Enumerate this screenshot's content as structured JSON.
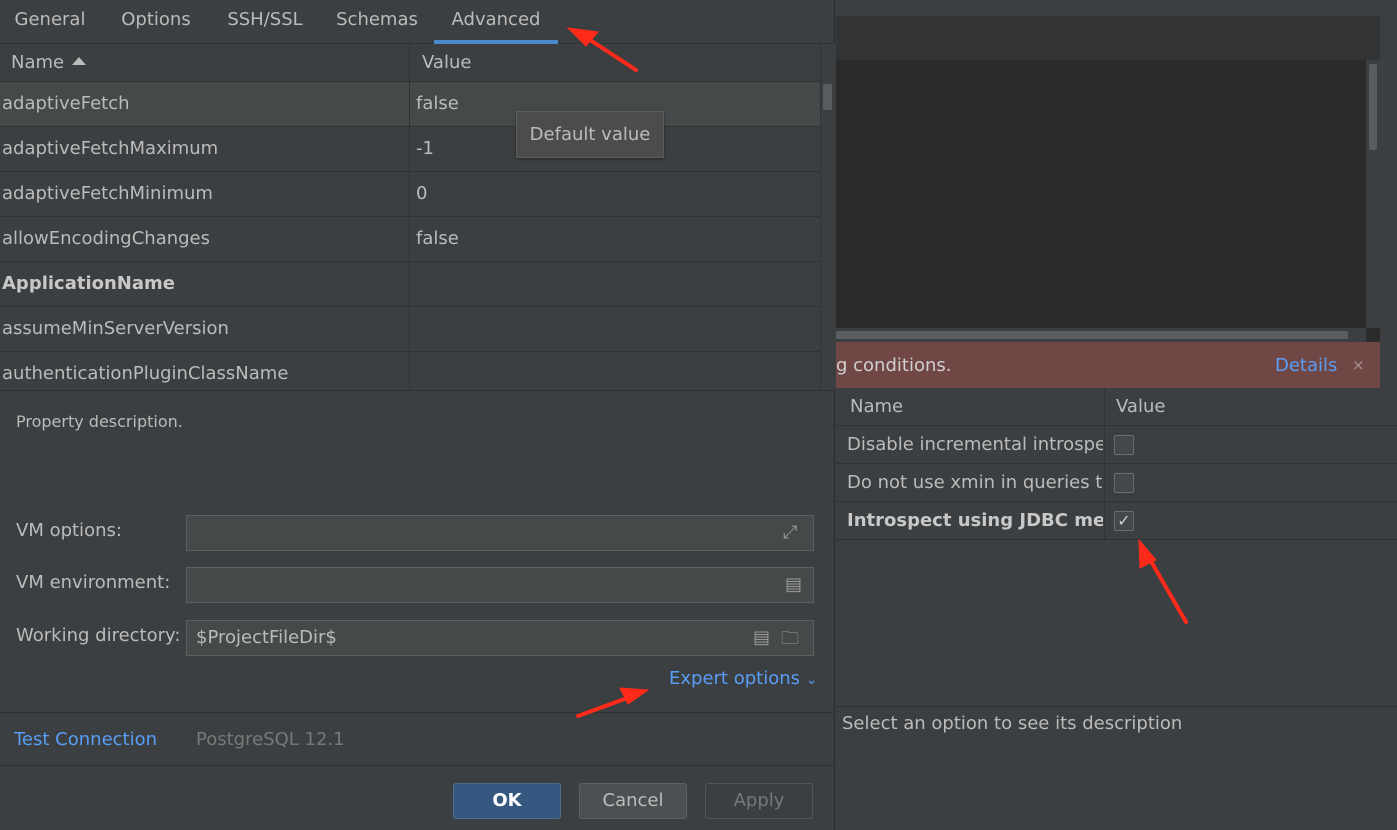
{
  "tabs": [
    {
      "label": "General"
    },
    {
      "label": "Options"
    },
    {
      "label": "SSH/SSL"
    },
    {
      "label": "Schemas"
    },
    {
      "label": "Advanced"
    }
  ],
  "active_tab": "Advanced",
  "properties_grid": {
    "col_name": "Name",
    "col_value": "Value",
    "rows": [
      {
        "name": "adaptiveFetch",
        "value": "false"
      },
      {
        "name": "adaptiveFetchMaximum",
        "value": "-1"
      },
      {
        "name": "adaptiveFetchMinimum",
        "value": "0"
      },
      {
        "name": "allowEncodingChanges",
        "value": "false"
      },
      {
        "name": "ApplicationName",
        "value": ""
      },
      {
        "name": "assumeMinServerVersion",
        "value": ""
      },
      {
        "name": "authenticationPluginClassName",
        "value": ""
      }
    ]
  },
  "tooltip": "Default value",
  "property_description": "Property description.",
  "fields": {
    "vm_options_label": "VM options:",
    "vm_options_value": "",
    "vm_env_label": "VM environment:",
    "vm_env_value": "",
    "workdir_label": "Working directory:",
    "workdir_value": "$ProjectFileDir$"
  },
  "expert_options": "Expert options",
  "footer": {
    "test_connection": "Test Connection",
    "db_version": "PostgreSQL 12.1",
    "ok": "OK",
    "cancel": "Cancel",
    "apply": "Apply"
  },
  "right_panel": {
    "error_text": "g conditions.",
    "details": "Details",
    "close": "×",
    "col_name": "Name",
    "col_value": "Value",
    "options": [
      {
        "name": "Disable incremental introspec",
        "checked": false
      },
      {
        "name": "Do not use xmin in queries to",
        "checked": false
      },
      {
        "name": "Introspect using JDBC metac",
        "checked": true
      }
    ],
    "description": "Select an option to see its description"
  },
  "colors": {
    "background": "#3c3f41",
    "accent": "#4a88c7",
    "link": "#589df6",
    "ok_button": "#365880",
    "error_bar": "#704745",
    "annotation_arrow": "#ff2a1a"
  }
}
